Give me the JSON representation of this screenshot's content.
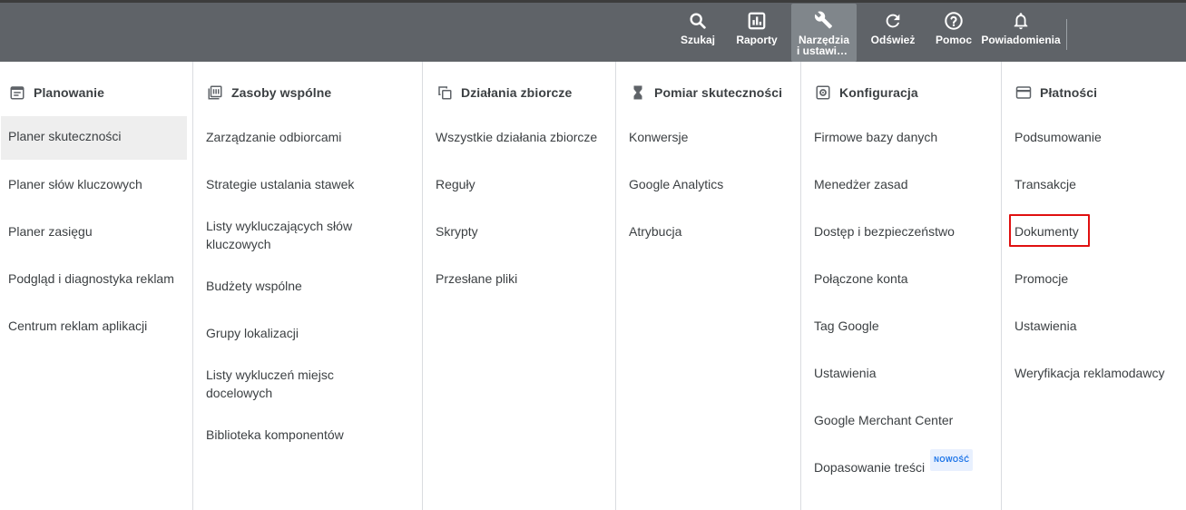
{
  "toolbar": {
    "search": "Szukaj",
    "reports": "Raporty",
    "tools_line1": "Narzędzia",
    "tools_line2": "i ustawienia",
    "refresh": "Odśwież",
    "help": "Pomoc",
    "notifications": "Powiadomienia"
  },
  "columns": {
    "planning": {
      "title": "Planowanie",
      "items": [
        "Planer skuteczności",
        "Planer słów kluczowych",
        "Planer zasięgu",
        "Podgląd i diagnostyka reklam",
        "Centrum reklam aplikacji"
      ]
    },
    "shared": {
      "title": "Zasoby wspólne",
      "items": [
        "Zarządzanie odbiorcami",
        "Strategie ustalania stawek",
        "Listy wykluczających słów kluczowych",
        "Budżety wspólne",
        "Grupy lokalizacji",
        "Listy wykluczeń miejsc docelowych",
        "Biblioteka komponentów"
      ]
    },
    "bulk": {
      "title": "Działania zbiorcze",
      "items": [
        "Wszystkie działania zbiorcze",
        "Reguły",
        "Skrypty",
        "Przesłane pliki"
      ]
    },
    "measurement": {
      "title": "Pomiar skuteczności",
      "items": [
        "Konwersje",
        "Google Analytics",
        "Atrybucja"
      ]
    },
    "setup": {
      "title": "Konfiguracja",
      "items": [
        "Firmowe bazy danych",
        "Menedżer zasad",
        "Dostęp i bezpieczeństwo",
        "Połączone konta",
        "Tag Google",
        "Ustawienia",
        "Google Merchant Center",
        "Dopasowanie treści"
      ],
      "new_badge": "NOWOŚĆ"
    },
    "billing": {
      "title": "Płatności",
      "items": [
        "Podsumowanie",
        "Transakcje",
        "Dokumenty",
        "Promocje",
        "Ustawienia",
        "Weryfikacja reklamodawcy"
      ]
    }
  },
  "colors": {
    "toolbar_bg": "#5f6368",
    "active_tool_bg": "#80868b",
    "selected_item_bg": "#eeeeee",
    "highlight_border": "#e01010",
    "badge_text": "#1a73e8"
  }
}
